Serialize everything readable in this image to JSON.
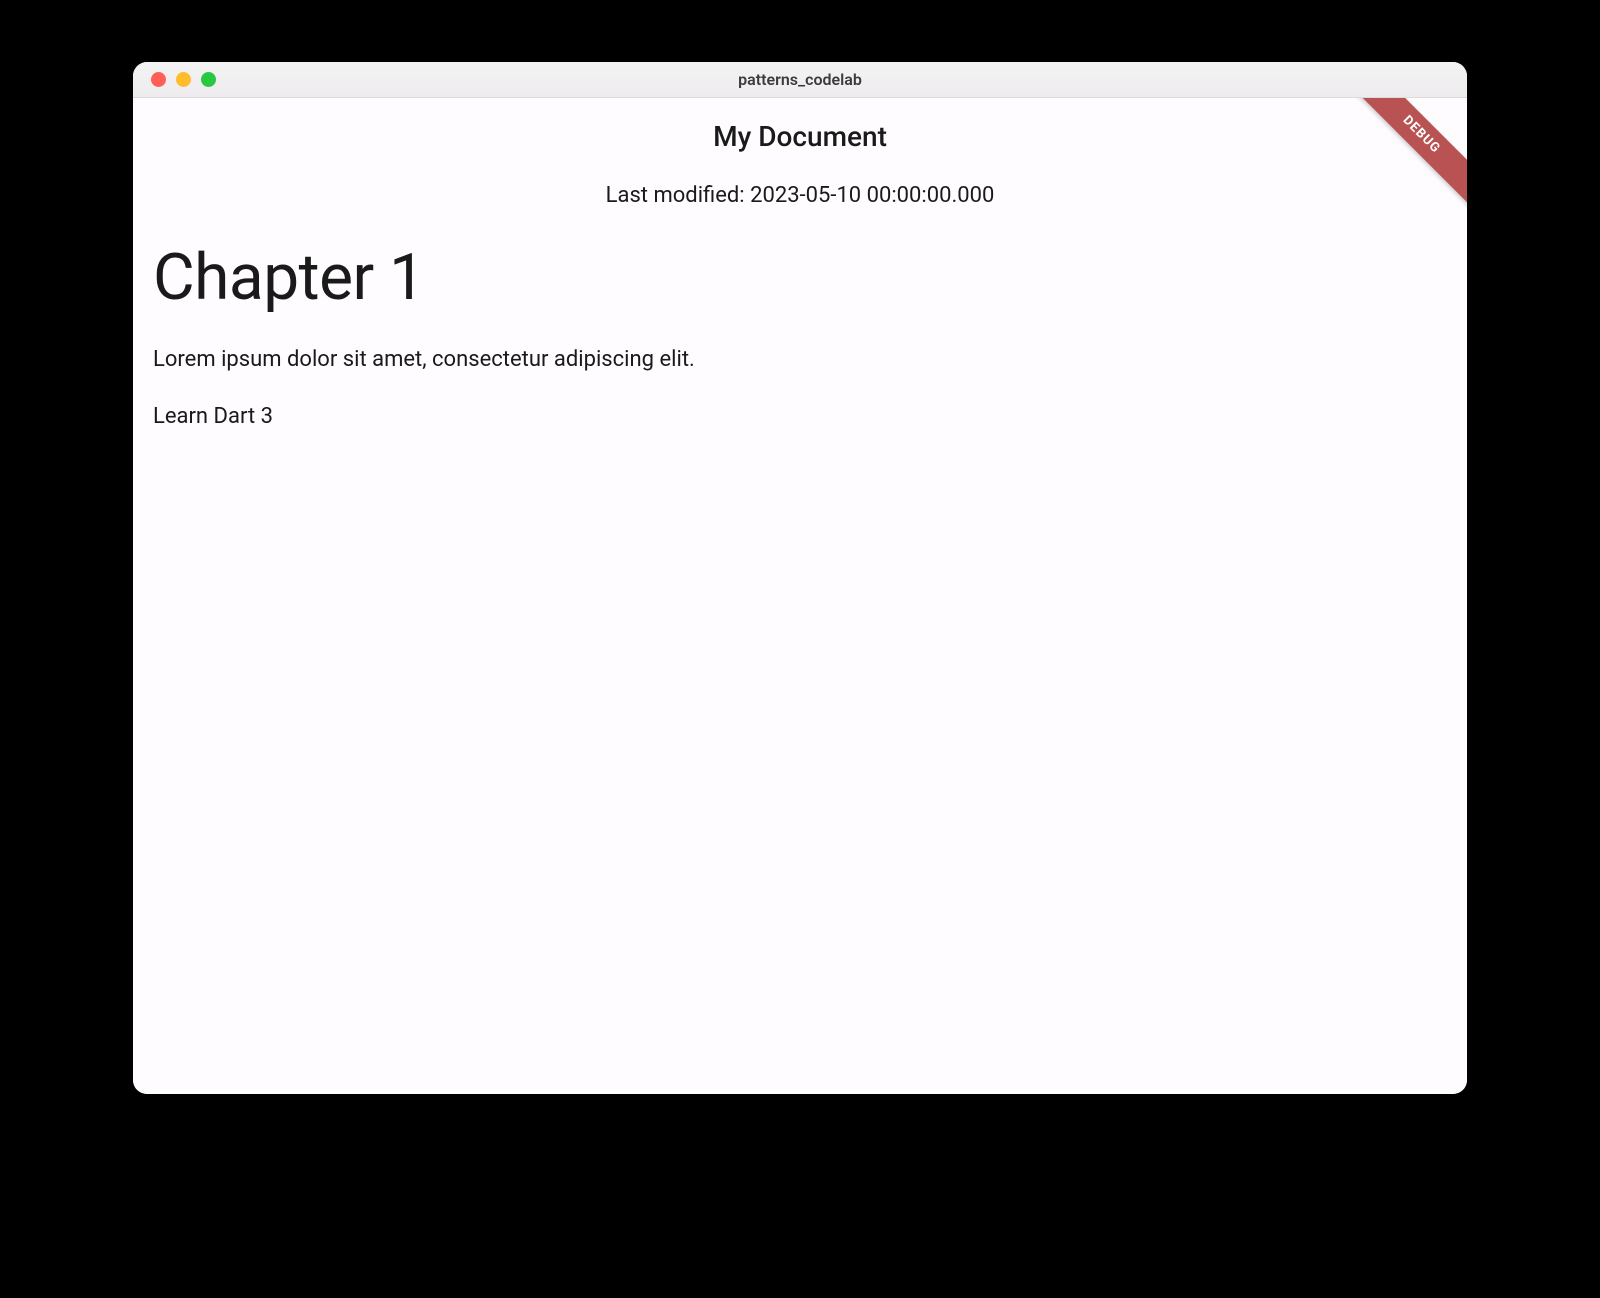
{
  "window": {
    "title": "patterns_codelab"
  },
  "debug_banner": {
    "label": "DEBUG"
  },
  "document": {
    "title": "My Document",
    "modified_label": "Last modified: 2023-05-10 00:00:00.000",
    "blocks": [
      {
        "type": "heading",
        "text": "Chapter 1"
      },
      {
        "type": "paragraph",
        "text": "Lorem ipsum dolor sit amet, consectetur adipiscing elit."
      },
      {
        "type": "checkbox",
        "text": "Learn Dart 3"
      }
    ]
  }
}
